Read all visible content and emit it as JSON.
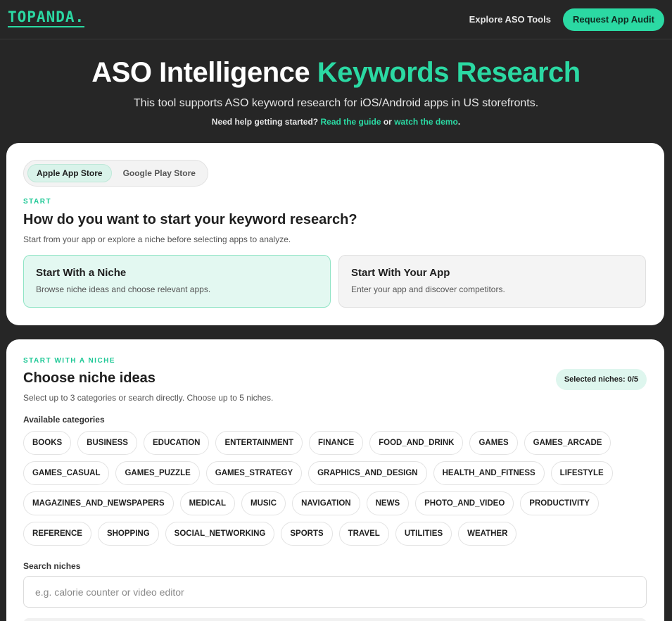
{
  "header": {
    "logo": "TOPANDA.",
    "explore_label": "Explore ASO Tools",
    "audit_label": "Request App Audit"
  },
  "hero": {
    "title_main": "ASO Intelligence",
    "title_accent": "Keywords Research",
    "subtitle": "This tool supports ASO keyword research for iOS/Android apps in US storefronts.",
    "help_prefix": "Need help getting started?",
    "guide_link": "Read the guide",
    "help_or": "or",
    "demo_link": "watch the demo",
    "help_suffix": "."
  },
  "start_card": {
    "stores": [
      "Apple App Store",
      "Google Play Store"
    ],
    "active_store": "Apple App Store",
    "eyebrow": "START",
    "title": "How do you want to start your keyword research?",
    "description": "Start from your app or explore a niche before selecting apps to analyze.",
    "options": [
      {
        "title": "Start With a Niche",
        "desc": "Browse niche ideas and choose relevant apps."
      },
      {
        "title": "Start With Your App",
        "desc": "Enter your app and discover competitors."
      }
    ]
  },
  "niche_card": {
    "eyebrow": "START WITH A NICHE",
    "title": "Choose niche ideas",
    "description": "Select up to 3 categories or search directly. Choose up to 5 niches.",
    "selected_label": "Selected niches: 0/5",
    "categories_label": "Available categories",
    "categories": [
      "BOOKS",
      "BUSINESS",
      "EDUCATION",
      "ENTERTAINMENT",
      "FINANCE",
      "FOOD_AND_DRINK",
      "GAMES",
      "GAMES_ARCADE",
      "GAMES_CASUAL",
      "GAMES_PUZZLE",
      "GAMES_STRATEGY",
      "GRAPHICS_AND_DESIGN",
      "HEALTH_AND_FITNESS",
      "LIFESTYLE",
      "MAGAZINES_AND_NEWSPAPERS",
      "MEDICAL",
      "MUSIC",
      "NAVIGATION",
      "NEWS",
      "PHOTO_AND_VIDEO",
      "PRODUCTIVITY",
      "REFERENCE",
      "SHOPPING",
      "SOCIAL_NETWORKING",
      "SPORTS",
      "TRAVEL",
      "UTILITIES",
      "WEATHER"
    ],
    "search_label": "Search niches",
    "search_placeholder": "e.g. calorie counter or video editor"
  }
}
